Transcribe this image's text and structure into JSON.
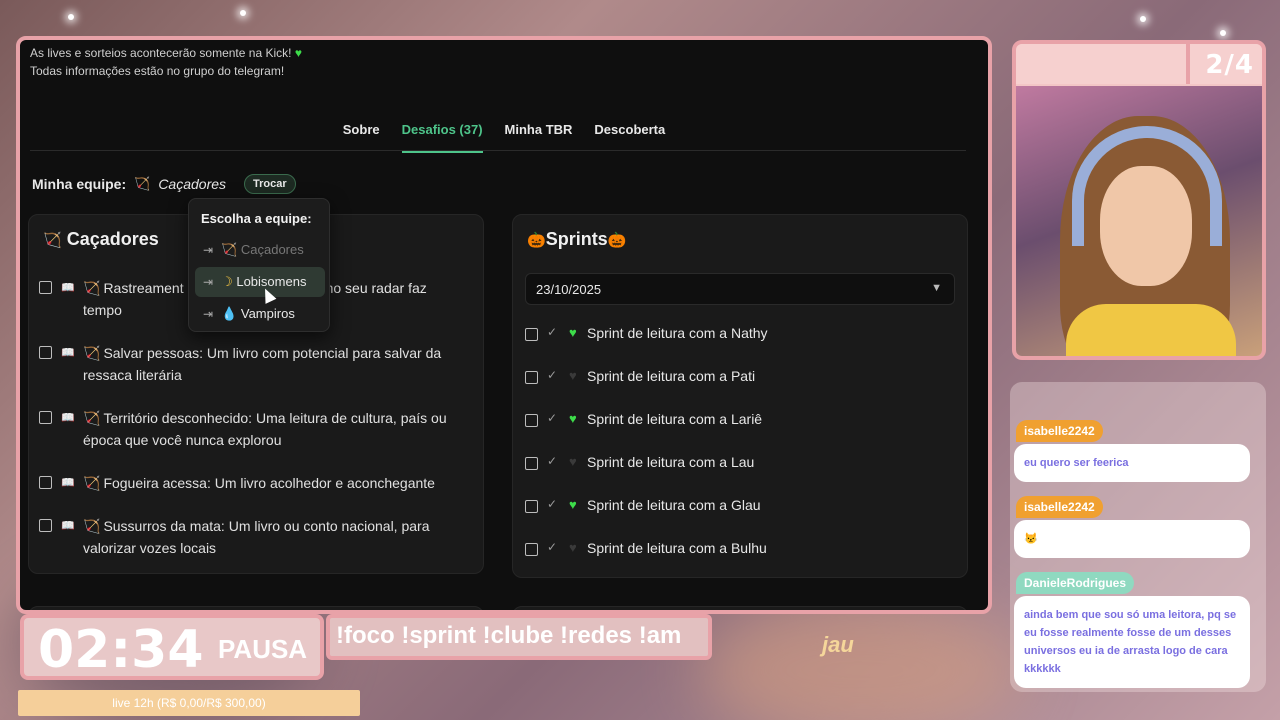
{
  "notice": {
    "line1": "As lives e sorteios acontecerão somente na Kick!",
    "line2": "Todas informações estão no grupo do telegram!"
  },
  "tabs": [
    {
      "label": "Sobre"
    },
    {
      "label": "Desafios (37)"
    },
    {
      "label": "Minha TBR"
    },
    {
      "label": "Descoberta"
    }
  ],
  "team": {
    "label": "Minha equipe:",
    "name": "Caçadores",
    "switch_label": "Trocar"
  },
  "dropdown": {
    "title": "Escolha a equipe:",
    "items": [
      {
        "label": "Caçadores",
        "icon": "bow-icon"
      },
      {
        "label": "Lobisomens",
        "icon": "moon-icon"
      },
      {
        "label": "Vampiros",
        "icon": "blood-drop-icon"
      }
    ]
  },
  "left_panel": {
    "title": "Caçadores",
    "tasks": [
      {
        "text_start": "Rastreament",
        "text_end": "no seu radar faz",
        "text_line2": "tempo"
      },
      {
        "text": "Salvar pessoas: Um livro com potencial para salvar da ressaca literária"
      },
      {
        "text": "Território desconhecido: Uma leitura de cultura, país ou época que você nunca explorou"
      },
      {
        "text": "Fogueira acessa: Um livro acolhedor e aconchegante"
      },
      {
        "text": "Sussurros da mata: Um livro ou conto nacional, para valorizar vozes locais"
      }
    ]
  },
  "right_panel": {
    "title": "Sprints",
    "date": "23/10/2025",
    "sprints": [
      {
        "text": "Sprint de leitura com a Nathy",
        "heart_color": "#3ddc4a"
      },
      {
        "text": "Sprint de leitura com a Pati",
        "heart_color": "#3a3a3a"
      },
      {
        "text": "Sprint de leitura com a Lariê",
        "heart_color": "#3ddc4a"
      },
      {
        "text": "Sprint de leitura com a Lau",
        "heart_color": "#3a3a3a"
      },
      {
        "text": "Sprint de leitura com a Glau",
        "heart_color": "#3ddc4a"
      },
      {
        "text": "Sprint de leitura com a Bulhu",
        "heart_color": "#3a3a3a"
      }
    ]
  },
  "cam": {
    "counter": "2/4"
  },
  "chat": [
    {
      "user": "isabelle2242",
      "user_color": "#f0a030",
      "message": "eu quero ser feerica"
    },
    {
      "user": "isabelle2242",
      "user_color": "#f0a030",
      "message": "😾"
    },
    {
      "user": "DanieleRodrigues",
      "user_color": "#8fd9c0",
      "message": "ainda bem que sou só uma leitora, pq se eu fosse realmente fosse de um desses universos eu ia de arrasta logo de cara kkkkkk"
    }
  ],
  "timer": {
    "time": "02:34",
    "status": "PAUSA"
  },
  "marquee": "!foco !sprint !clube !redes !am",
  "goal": "live 12h (R$ 0,00/R$ 300,00)",
  "logo": "jau",
  "colors": {
    "accent": "#4ec48a",
    "frame": "#e8a2a8",
    "panel": "#1a1a1a"
  }
}
